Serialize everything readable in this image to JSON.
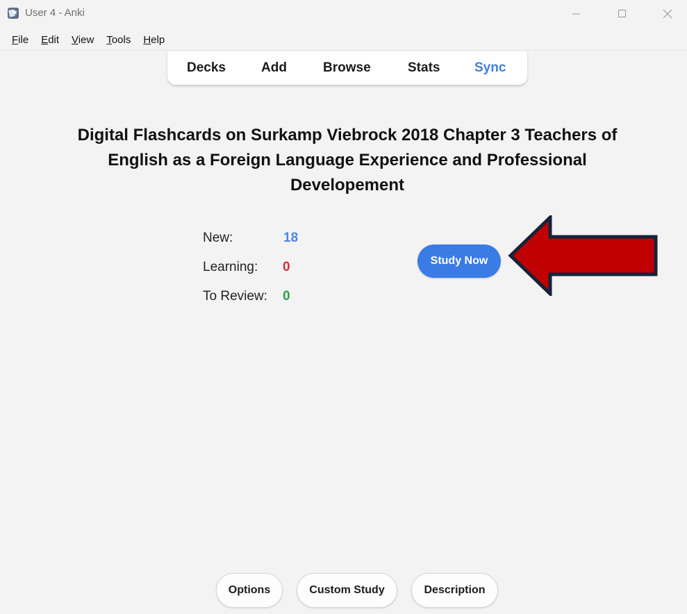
{
  "window": {
    "title": "User 4 - Anki"
  },
  "menu": {
    "items": [
      {
        "first": "F",
        "rest": "ile"
      },
      {
        "first": "E",
        "rest": "dit"
      },
      {
        "first": "V",
        "rest": "iew"
      },
      {
        "first": "T",
        "rest": "ools"
      },
      {
        "first": "H",
        "rest": "elp"
      }
    ]
  },
  "toolbar": {
    "decks": "Decks",
    "add": "Add",
    "browse": "Browse",
    "stats": "Stats",
    "sync": "Sync"
  },
  "deck": {
    "title": "Digital Flashcards on Surkamp Viebrock 2018 Chapter 3 Teachers of English as a Foreign Language Experience and Professional Developement"
  },
  "counts": {
    "new_label": "New:",
    "new_value": "18",
    "learning_label": "Learning:",
    "learning_value": "0",
    "review_label": "To Review:",
    "review_value": "0"
  },
  "actions": {
    "study_now": "Study Now",
    "options": "Options",
    "custom_study": "Custom Study",
    "description": "Description"
  },
  "colors": {
    "accent_blue": "#3b7be6",
    "new_count": "#4a86e8",
    "learning_count": "#d32f2f",
    "review_count": "#2e9e47",
    "annotation_arrow": "#c00000"
  },
  "icons": {
    "app": "anki-icon",
    "minimize": "minimize-icon",
    "maximize": "maximize-icon",
    "close": "close-icon",
    "annotation": "arrow-left-annotation"
  }
}
